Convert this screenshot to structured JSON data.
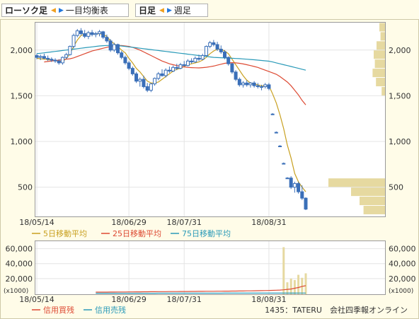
{
  "toolbar": {
    "chart_type": "ローソク足",
    "alt_type": "一目均衡表",
    "period": "日足",
    "alt_period": "週足"
  },
  "legend_main": [
    {
      "label": "5日移動平均",
      "color": "#c8a020"
    },
    {
      "label": "25日移動平均",
      "color": "#dd4a33"
    },
    {
      "label": "75日移動平均",
      "color": "#2a9ab8"
    }
  ],
  "legend_volume": [
    {
      "label": "信用買残",
      "color": "#dd4a33"
    },
    {
      "label": "信用売残",
      "color": "#2a9ab8"
    }
  ],
  "footer": {
    "source": "1435：TATERU　会社四季報オンライン"
  },
  "colors": {
    "candle": "#3a6fb8",
    "ma5": "#c8a020",
    "ma25": "#dd4a33",
    "ma75": "#2a9ab8",
    "volume_bar": "#e6d9a0",
    "volume_profile": "#e6d9a0",
    "grid": "#e4e4e4",
    "frame": "#999999"
  },
  "chart_data": [
    {
      "type": "candlestick",
      "y_ticks": [
        "2,000",
        "1,500",
        "1,000",
        "500"
      ],
      "ylim": [
        180,
        2300
      ],
      "x_ticks": [
        "18/05/14",
        "18/06/29",
        "18/07/31",
        "18/08/31"
      ],
      "candles": [
        {
          "o": 1940,
          "h": 1960,
          "l": 1900,
          "c": 1920
        },
        {
          "o": 1920,
          "h": 1950,
          "l": 1890,
          "c": 1930
        },
        {
          "o": 1930,
          "h": 1960,
          "l": 1900,
          "c": 1910
        },
        {
          "o": 1910,
          "h": 1940,
          "l": 1880,
          "c": 1900
        },
        {
          "o": 1900,
          "h": 1920,
          "l": 1870,
          "c": 1890
        },
        {
          "o": 1890,
          "h": 1910,
          "l": 1860,
          "c": 1880
        },
        {
          "o": 1880,
          "h": 1900,
          "l": 1840,
          "c": 1860
        },
        {
          "o": 1860,
          "h": 1930,
          "l": 1840,
          "c": 1920
        },
        {
          "o": 1920,
          "h": 1970,
          "l": 1900,
          "c": 1950
        },
        {
          "o": 1950,
          "h": 2050,
          "l": 1940,
          "c": 2040
        },
        {
          "o": 2040,
          "h": 2180,
          "l": 2020,
          "c": 2160
        },
        {
          "o": 2160,
          "h": 2230,
          "l": 2140,
          "c": 2210
        },
        {
          "o": 2210,
          "h": 2240,
          "l": 2160,
          "c": 2180
        },
        {
          "o": 2180,
          "h": 2220,
          "l": 2130,
          "c": 2150
        },
        {
          "o": 2150,
          "h": 2210,
          "l": 2120,
          "c": 2190
        },
        {
          "o": 2190,
          "h": 2220,
          "l": 2150,
          "c": 2170
        },
        {
          "o": 2170,
          "h": 2200,
          "l": 2140,
          "c": 2180
        },
        {
          "o": 2180,
          "h": 2220,
          "l": 2150,
          "c": 2200
        },
        {
          "o": 2200,
          "h": 2210,
          "l": 2120,
          "c": 2140
        },
        {
          "o": 2140,
          "h": 2170,
          "l": 2080,
          "c": 2100
        },
        {
          "o": 2100,
          "h": 2120,
          "l": 1980,
          "c": 2000
        },
        {
          "o": 2000,
          "h": 2080,
          "l": 1980,
          "c": 2060
        },
        {
          "o": 2060,
          "h": 2070,
          "l": 1950,
          "c": 1970
        },
        {
          "o": 1970,
          "h": 1990,
          "l": 1900,
          "c": 1920
        },
        {
          "o": 1920,
          "h": 1940,
          "l": 1840,
          "c": 1860
        },
        {
          "o": 1860,
          "h": 1880,
          "l": 1780,
          "c": 1800
        },
        {
          "o": 1800,
          "h": 1820,
          "l": 1720,
          "c": 1740
        },
        {
          "o": 1740,
          "h": 1760,
          "l": 1640,
          "c": 1660
        },
        {
          "o": 1660,
          "h": 1700,
          "l": 1600,
          "c": 1680
        },
        {
          "o": 1680,
          "h": 1720,
          "l": 1580,
          "c": 1600
        },
        {
          "o": 1600,
          "h": 1640,
          "l": 1540,
          "c": 1560
        },
        {
          "o": 1560,
          "h": 1640,
          "l": 1540,
          "c": 1630
        },
        {
          "o": 1630,
          "h": 1700,
          "l": 1610,
          "c": 1690
        },
        {
          "o": 1690,
          "h": 1760,
          "l": 1670,
          "c": 1740
        },
        {
          "o": 1740,
          "h": 1790,
          "l": 1710,
          "c": 1720
        },
        {
          "o": 1720,
          "h": 1800,
          "l": 1700,
          "c": 1780
        },
        {
          "o": 1780,
          "h": 1820,
          "l": 1750,
          "c": 1770
        },
        {
          "o": 1770,
          "h": 1830,
          "l": 1760,
          "c": 1810
        },
        {
          "o": 1810,
          "h": 1850,
          "l": 1780,
          "c": 1800
        },
        {
          "o": 1800,
          "h": 1860,
          "l": 1790,
          "c": 1840
        },
        {
          "o": 1840,
          "h": 1880,
          "l": 1820,
          "c": 1830
        },
        {
          "o": 1830,
          "h": 1900,
          "l": 1820,
          "c": 1880
        },
        {
          "o": 1880,
          "h": 1910,
          "l": 1850,
          "c": 1870
        },
        {
          "o": 1870,
          "h": 1930,
          "l": 1860,
          "c": 1910
        },
        {
          "o": 1910,
          "h": 1950,
          "l": 1880,
          "c": 1900
        },
        {
          "o": 1900,
          "h": 1960,
          "l": 1890,
          "c": 1940
        },
        {
          "o": 1940,
          "h": 2050,
          "l": 1930,
          "c": 2040
        },
        {
          "o": 2040,
          "h": 2100,
          "l": 2020,
          "c": 2080
        },
        {
          "o": 2080,
          "h": 2110,
          "l": 2040,
          "c": 2060
        },
        {
          "o": 2060,
          "h": 2090,
          "l": 1990,
          "c": 2010
        },
        {
          "o": 2010,
          "h": 2050,
          "l": 1960,
          "c": 1980
        },
        {
          "o": 1980,
          "h": 2000,
          "l": 1900,
          "c": 1920
        },
        {
          "o": 1920,
          "h": 1930,
          "l": 1830,
          "c": 1850
        },
        {
          "o": 1850,
          "h": 1860,
          "l": 1740,
          "c": 1760
        },
        {
          "o": 1760,
          "h": 1780,
          "l": 1660,
          "c": 1680
        },
        {
          "o": 1680,
          "h": 1700,
          "l": 1600,
          "c": 1620
        },
        {
          "o": 1620,
          "h": 1660,
          "l": 1590,
          "c": 1640
        },
        {
          "o": 1640,
          "h": 1670,
          "l": 1600,
          "c": 1620
        },
        {
          "o": 1620,
          "h": 1650,
          "l": 1590,
          "c": 1640
        },
        {
          "o": 1640,
          "h": 1660,
          "l": 1590,
          "c": 1610
        },
        {
          "o": 1610,
          "h": 1640,
          "l": 1580,
          "c": 1600
        },
        {
          "o": 1600,
          "h": 1620,
          "l": 1560,
          "c": 1600
        },
        {
          "o": 1600,
          "h": 1640,
          "l": 1580,
          "c": 1620
        },
        {
          "o": 1620,
          "h": 1640,
          "l": 1560,
          "c": 1580
        },
        {
          "o": 1300,
          "h": 1310,
          "l": 1290,
          "c": 1300
        },
        {
          "o": 1100,
          "h": 1110,
          "l": 1090,
          "c": 1100
        },
        {
          "o": 950,
          "h": 960,
          "l": 940,
          "c": 950
        },
        {
          "o": 760,
          "h": 770,
          "l": 750,
          "c": 760
        },
        {
          "o": 600,
          "h": 610,
          "l": 590,
          "c": 600
        },
        {
          "o": 600,
          "h": 620,
          "l": 480,
          "c": 500
        },
        {
          "o": 500,
          "h": 560,
          "l": 440,
          "c": 540
        },
        {
          "o": 540,
          "h": 560,
          "l": 430,
          "c": 450
        },
        {
          "o": 450,
          "h": 520,
          "l": 360,
          "c": 380
        },
        {
          "o": 380,
          "h": 390,
          "l": 250,
          "c": 260
        }
      ],
      "series": [
        {
          "name": "5日移動平均",
          "values": [
            1910,
            1905,
            1900,
            1895,
            1890,
            1885,
            1880,
            1875,
            1905,
            1960,
            2040,
            2110,
            2160,
            2175,
            2180,
            2175,
            2175,
            2180,
            2170,
            2150,
            2100,
            2070,
            2040,
            2000,
            1970,
            1910,
            1860,
            1800,
            1760,
            1710,
            1660,
            1640,
            1640,
            1650,
            1680,
            1710,
            1740,
            1770,
            1790,
            1800,
            1820,
            1840,
            1850,
            1860,
            1870,
            1890,
            1920,
            1960,
            1990,
            2010,
            2010,
            1990,
            1960,
            1900,
            1840,
            1780,
            1720,
            1670,
            1640,
            1630,
            1620,
            1610,
            1610,
            1610,
            1520,
            1420,
            1290,
            1140,
            960,
            820,
            650,
            560,
            500,
            450
          ]
        },
        {
          "name": "25日移動平均",
          "values": [
            1870,
            1875,
            1880,
            1885,
            1890,
            1895,
            1900,
            1905,
            1915,
            1930,
            1945,
            1960,
            1975,
            1990,
            2000,
            2010,
            2020,
            2030,
            2040,
            2045,
            2050,
            2050,
            2045,
            2040,
            2030,
            2015,
            2000,
            1980,
            1960,
            1940,
            1920,
            1900,
            1880,
            1865,
            1850,
            1840,
            1830,
            1822,
            1815,
            1810,
            1808,
            1806,
            1805,
            1808,
            1812,
            1818,
            1825,
            1835,
            1845,
            1855,
            1860,
            1862,
            1860,
            1855,
            1848,
            1840,
            1830,
            1820,
            1810,
            1795,
            1780,
            1765,
            1750,
            1735,
            1710,
            1680,
            1650,
            1610,
            1560,
            1510,
            1450,
            1400
          ]
        },
        {
          "name": "75日移動平均",
          "values": [
            1960,
            1965,
            1970,
            1975,
            1980,
            1985,
            1990,
            1995,
            2000,
            2005,
            2010,
            2015,
            2020,
            2025,
            2030,
            2035,
            2040,
            2045,
            2048,
            2050,
            2050,
            2050,
            2048,
            2045,
            2040,
            2035,
            2030,
            2025,
            2020,
            2015,
            2010,
            2005,
            2000,
            1995,
            1990,
            1985,
            1980,
            1975,
            1970,
            1965,
            1960,
            1955,
            1950,
            1945,
            1940,
            1935,
            1930,
            1925,
            1920,
            1918,
            1916,
            1914,
            1912,
            1910,
            1908,
            1906,
            1903,
            1900,
            1897,
            1894,
            1890,
            1886,
            1882,
            1878,
            1870,
            1860,
            1850,
            1840,
            1830,
            1820,
            1810,
            1800,
            1790,
            1780
          ]
        }
      ],
      "volume_profile": [
        {
          "price": 2250,
          "value": 0.1
        },
        {
          "price": 2150,
          "value": 0.08
        },
        {
          "price": 2050,
          "value": 0.15
        },
        {
          "price": 1950,
          "value": 0.2
        },
        {
          "price": 1850,
          "value": 0.18
        },
        {
          "price": 1750,
          "value": 0.22
        },
        {
          "price": 1650,
          "value": 0.16
        },
        {
          "price": 1550,
          "value": 0.06
        },
        {
          "price": 550,
          "value": 1.0
        },
        {
          "price": 450,
          "value": 0.6
        },
        {
          "price": 350,
          "value": 0.45
        },
        {
          "price": 250,
          "value": 0.38
        }
      ]
    },
    {
      "type": "bar",
      "y_ticks": [
        "60,000",
        "40,000",
        "20,000"
      ],
      "unit_label": "(x1000)",
      "ylim": [
        -1000,
        70000
      ],
      "x_ticks": [
        "18/05/14",
        "18/06/29",
        "18/07/31",
        "18/08/31"
      ],
      "values": [
        62000,
        15000,
        20000,
        18000,
        25000,
        21000,
        27000
      ],
      "series": [
        {
          "name": "信用買残",
          "values": [
            1800,
            1800,
            1850,
            1850,
            1900,
            1900,
            2000,
            2000,
            2000,
            2100,
            2100,
            2200,
            2200,
            2300,
            2300,
            2400,
            2400,
            2500,
            2500,
            2500,
            2600,
            2600,
            2600,
            2700,
            2700,
            2700,
            2800,
            2800,
            2900,
            2900,
            3000,
            3000,
            3000,
            3100,
            3100,
            3200,
            3200,
            3300,
            3300,
            3400,
            3400,
            3500,
            3500,
            3600,
            3700,
            3800,
            3900,
            4000,
            4200,
            4400,
            4600,
            5000,
            5500,
            6000,
            7000,
            8000,
            9500,
            10500
          ]
        },
        {
          "name": "信用売残",
          "values": [
            300,
            300,
            300,
            300,
            320,
            320,
            320,
            330,
            330,
            340,
            340,
            350,
            350,
            360,
            360,
            370,
            370,
            380,
            380,
            390,
            390,
            400,
            400,
            410,
            410,
            420,
            420,
            430,
            430,
            440,
            440,
            450,
            450,
            460,
            460,
            470,
            470,
            480,
            480,
            490,
            490,
            500,
            500,
            510,
            510,
            520,
            520,
            530,
            530,
            540,
            540,
            550,
            550,
            560,
            560,
            570,
            580,
            600
          ]
        }
      ]
    }
  ]
}
